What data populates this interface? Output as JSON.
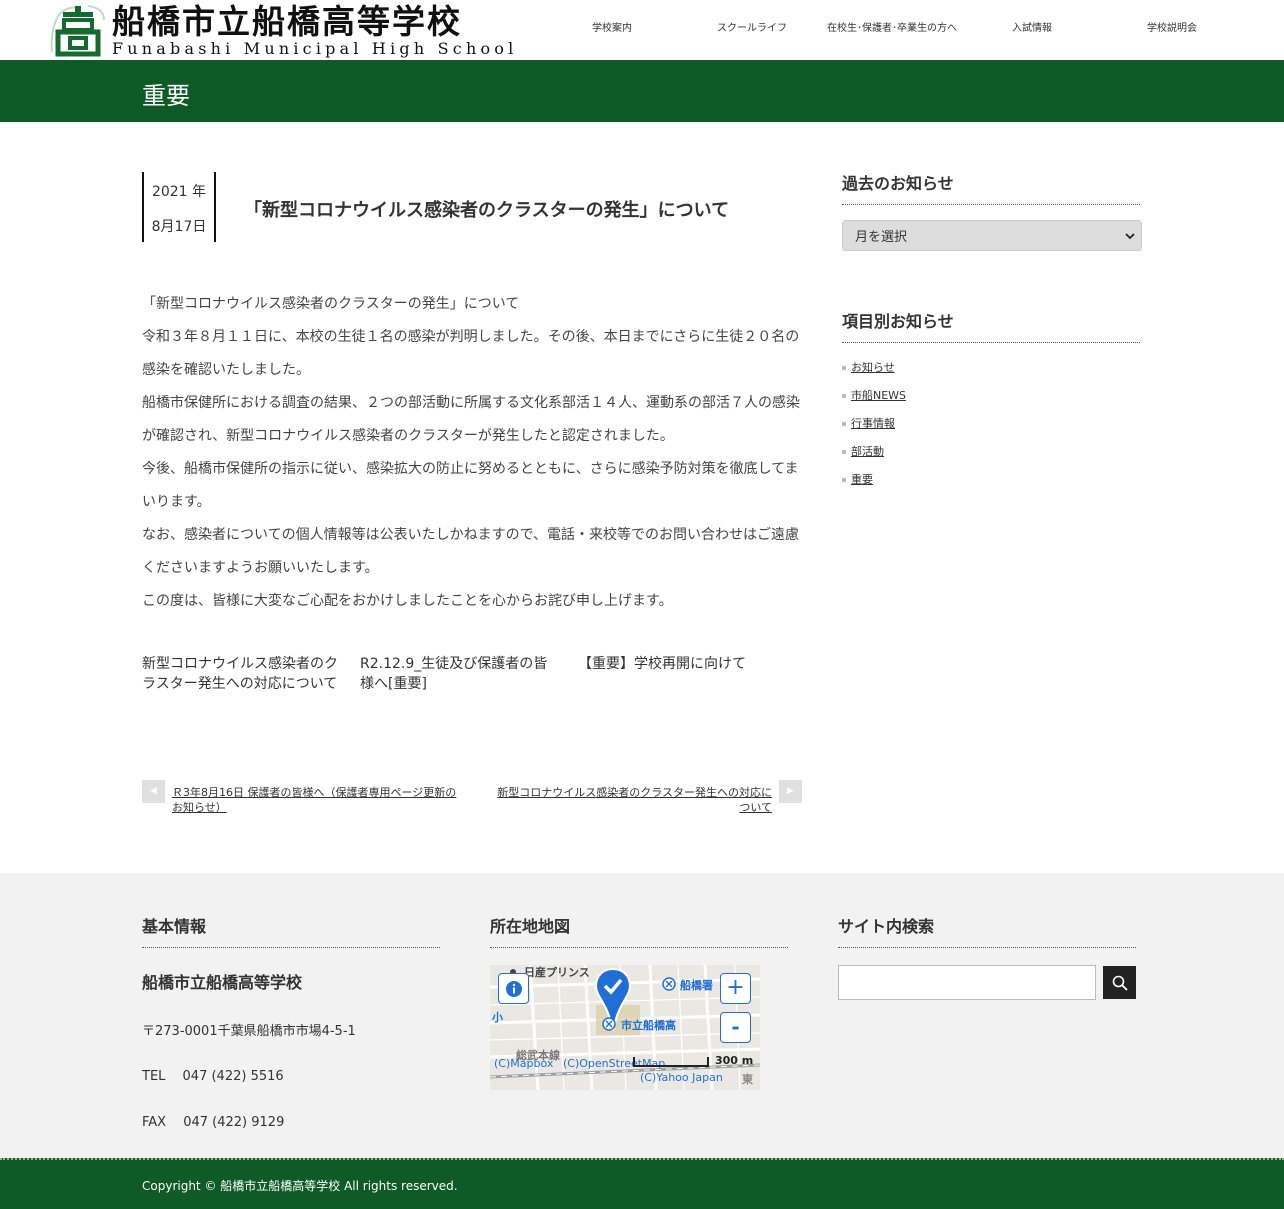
{
  "header": {
    "logo_jp": "船橋市立船橋高等学校",
    "logo_en": "Funabashi Municipal High School",
    "nav": [
      "学校案内",
      "スクールライフ",
      "在校生･保護者･卒業生の方へ",
      "入試情報",
      "学校説明会"
    ]
  },
  "page_title": "重要",
  "post": {
    "year": "2021 年",
    "day": "8月17日",
    "title": "「新型コロナウイルス感染者のクラスターの発生」について",
    "paragraphs": [
      "「新型コロナウイルス感染者のクラスターの発生」について",
      "令和３年８月１１日に、本校の生徒１名の感染が判明しました。その後、本日までにさらに生徒２０名の感染を確認いたしました。",
      "船橋市保健所における調査の結果、２つの部活動に所属する文化系部活１４人、運動系の部活７人の感染が確認され、新型コロナウイルス感染者のクラスターが発生したと認定されました。",
      "今後、船橋市保健所の指示に従い、感染拡大の防止に努めるとともに、さらに感染予防対策を徹底してまいります。",
      "なお、感染者についての個人情報等は公表いたしかねますので、電話・来校等でのお問い合わせはご遠慮くださいますようお願いいたします。",
      "この度は、皆様に大変なご心配をおかけしましたことを心からお詫び申し上げます。"
    ],
    "related": [
      "新型コロナウイルス感染者のクラスター発生への対応について",
      "R2.12.9_生徒及び保護者の皆様へ[重要]",
      "【重要】学校再開に向けて"
    ],
    "prev_link": "Ｒ3年8月16日 保護者の皆様へ（保護者専用ページ更新のお知らせ）",
    "next_link": "新型コロナウイルス感染者のクラスター発生への対応について"
  },
  "sidebar": {
    "archive_heading": "過去のお知らせ",
    "archive_select": "月を選択",
    "category_heading": "項目別お知らせ",
    "categories": [
      "お知らせ",
      "市船NEWS",
      "行事情報",
      "部活動",
      "重要"
    ]
  },
  "footer": {
    "info_heading": "基本情報",
    "school_name": "船橋市立船橋高等学校",
    "address": "〒273-0001千葉県船橋市市場4-5-1",
    "tel": "TEL　 047 (422) 5516",
    "fax": "FAX　 047 (422) 9129",
    "map_heading": "所在地地図",
    "map": {
      "label_school": "市立船橋高",
      "label_nissan": "日産プリンス",
      "label_funabashi": "船橋署",
      "label_sho": "小",
      "label_east": "東",
      "label_misc": "総武本線",
      "scale": "300 m",
      "credits_1": "(C)Mapbox",
      "credits_2": "(C)OpenStreetMap",
      "credits_3": "(C)Yahoo Japan",
      "zoom_in": "+",
      "zoom_out": "-"
    },
    "search_heading": "サイト内検索",
    "copyright": "Copyright ©  船橋市立船橋高等学校 All rights reserved."
  },
  "colors": {
    "brand_green": "#0e5b28",
    "footer_bg": "#f2f2f2",
    "map_pin": "#1f6fd6"
  }
}
